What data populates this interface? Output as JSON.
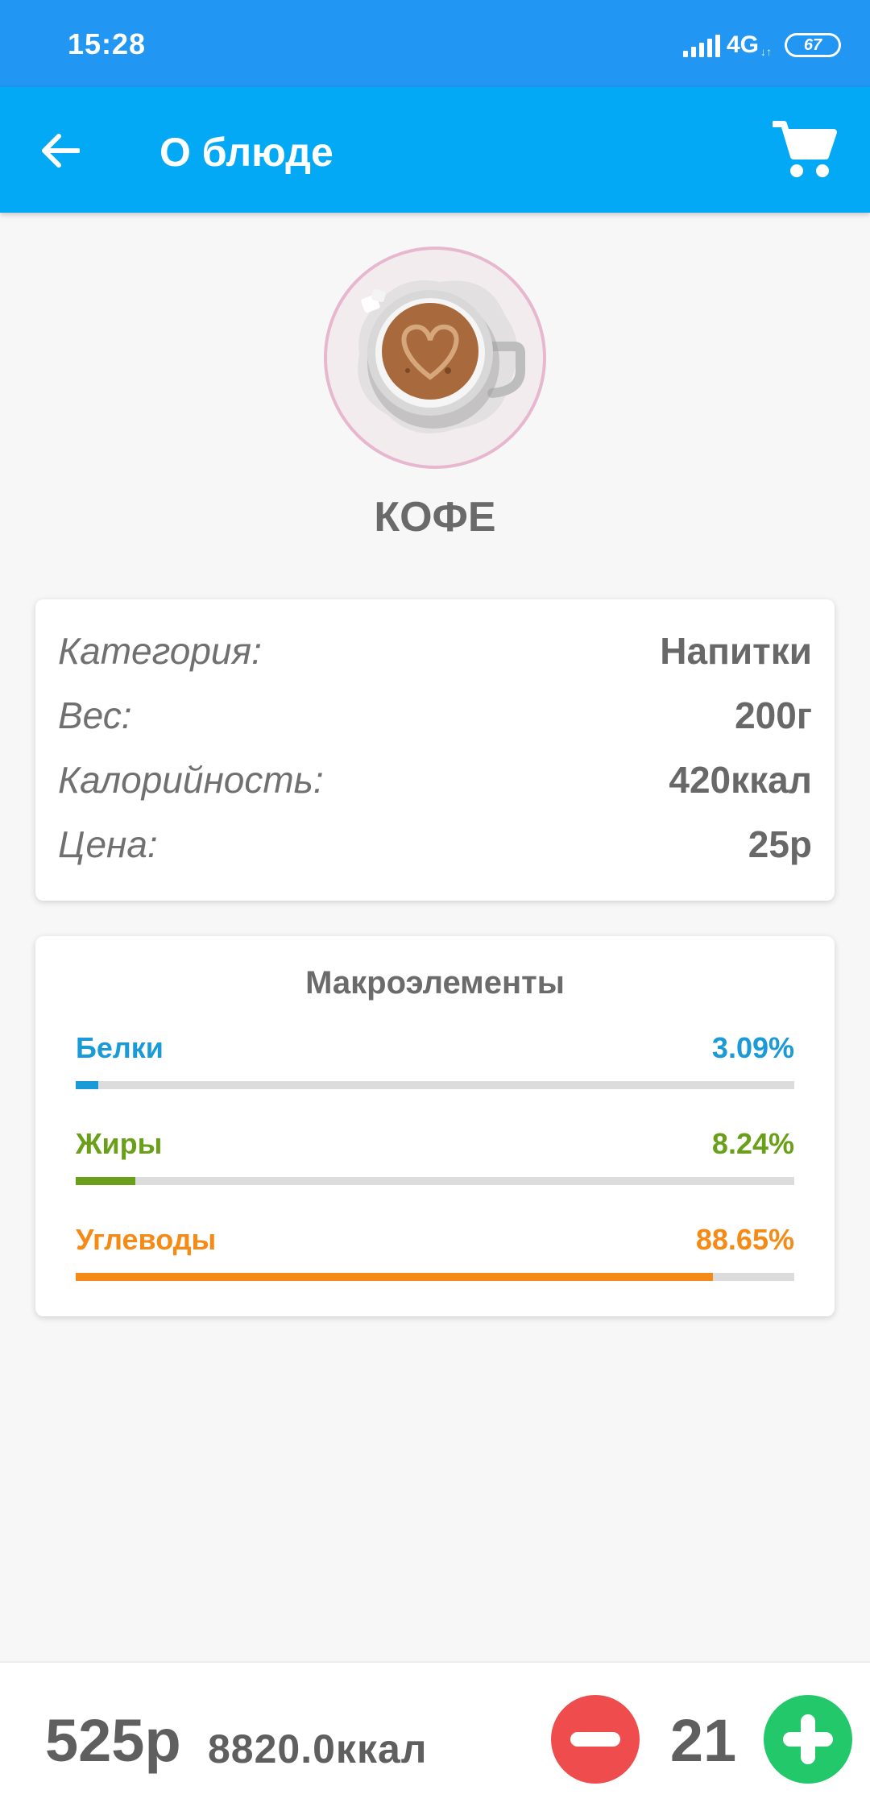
{
  "status_bar": {
    "time": "15:28",
    "network": "4G",
    "network_sub": "↓↑",
    "battery": "67"
  },
  "app_bar": {
    "title": "О блюде",
    "back_icon": "arrow-left-icon",
    "cart_icon": "shopping-cart-icon"
  },
  "dish": {
    "name": "КОФЕ",
    "image_icon": "coffee-cup-image"
  },
  "info": [
    {
      "label": "Категория:",
      "value": "Напитки"
    },
    {
      "label": "Вес:",
      "value": "200г"
    },
    {
      "label": "Калорийность:",
      "value": "420ккал"
    },
    {
      "label": "Цена:",
      "value": "25р"
    }
  ],
  "macros": {
    "title": "Макроэлементы",
    "items": [
      {
        "label": "Белки",
        "value": "3.09%",
        "percent": 3.09,
        "color": "#1a9ad6"
      },
      {
        "label": "Жиры",
        "value": "8.24%",
        "percent": 8.24,
        "color": "#6aa019"
      },
      {
        "label": "Углеводы",
        "value": "88.65%",
        "percent": 88.65,
        "color": "#f58b16"
      }
    ]
  },
  "bottom": {
    "total_price": "525р",
    "total_kcal": "8820.0ккал",
    "quantity": "21",
    "minus_icon": "minus-circle-icon",
    "plus_icon": "plus-circle-icon"
  },
  "colors": {
    "status_bar": "#2196f3",
    "app_bar": "#03a9f4",
    "minus": "#ef4d4d",
    "plus": "#23c86b"
  }
}
